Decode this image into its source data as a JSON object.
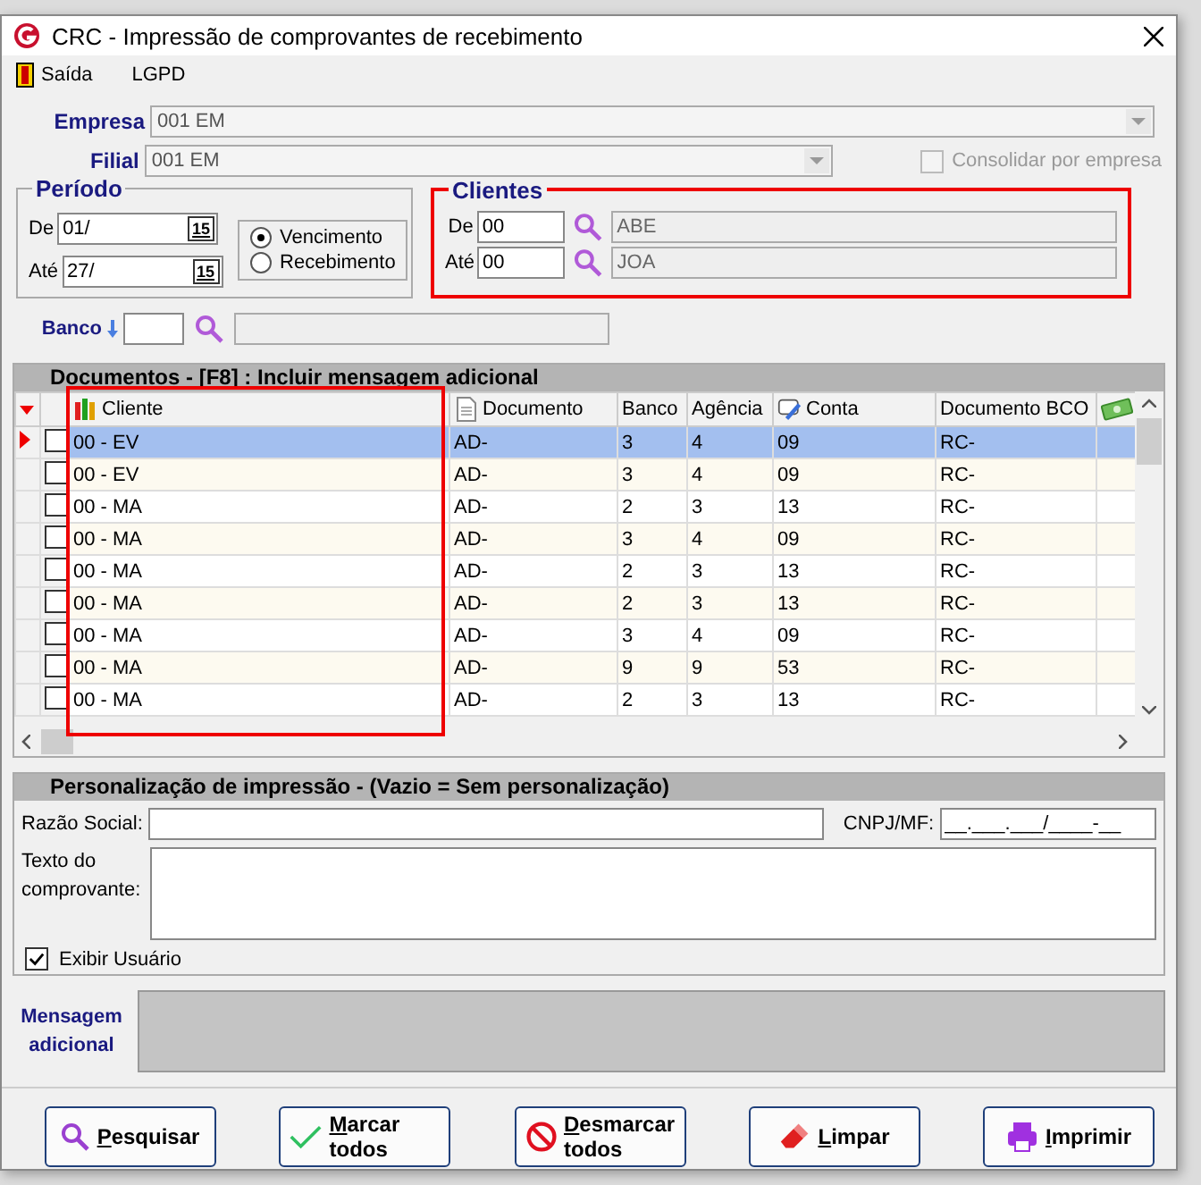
{
  "window": {
    "title": "CRC - Impressão de comprovantes de recebimento"
  },
  "menu": [
    "Saída",
    "LGPD"
  ],
  "empresa": {
    "label": "Empresa",
    "value": "001 EM"
  },
  "filial": {
    "label": "Filial",
    "value": "001 EM"
  },
  "consolidar": {
    "label": "Consolidar por empresa",
    "checked": false,
    "disabled": true
  },
  "periodo": {
    "title": "Período",
    "de_label": "De",
    "de": "01/",
    "ate_label": "Até",
    "ate": "27/",
    "de_calendar": "15",
    "ate_calendar": "15",
    "options": [
      {
        "label": "Vencimento",
        "selected": true
      },
      {
        "label": "Recebimento",
        "selected": false
      }
    ]
  },
  "clientes": {
    "title": "Clientes",
    "highlighted": true,
    "de_label": "De",
    "de_code": "00",
    "de_name": "ABE",
    "ate_label": "Até",
    "ate_code": "00",
    "ate_name": "JOA"
  },
  "banco": {
    "label": "Banco"
  },
  "documentos": {
    "title": "Documentos - [F8] : Incluir mensagem adicional",
    "columns": [
      {
        "label": "Cliente",
        "highlighted": true
      },
      {
        "label": "Documento"
      },
      {
        "label": "Banco"
      },
      {
        "label": "Agência"
      },
      {
        "label": "Conta"
      },
      {
        "label": "Documento BCO"
      }
    ],
    "rows": [
      {
        "selected": true,
        "checked": false,
        "cells": [
          "00 - EV",
          "AD-",
          "3",
          "4",
          "09",
          "RC-"
        ]
      },
      {
        "selected": false,
        "checked": false,
        "cells": [
          "00 - EV",
          "AD-",
          "3",
          "4",
          "09",
          "RC-"
        ]
      },
      {
        "selected": false,
        "checked": false,
        "cells": [
          "00 - MA",
          "AD-",
          "2",
          "3",
          "13",
          "RC-"
        ]
      },
      {
        "selected": false,
        "checked": false,
        "cells": [
          "00 - MA",
          "AD-",
          "3",
          "4",
          "09",
          "RC-"
        ]
      },
      {
        "selected": false,
        "checked": false,
        "cells": [
          "00 - MA",
          "AD-",
          "2",
          "3",
          "13",
          "RC-"
        ]
      },
      {
        "selected": false,
        "checked": false,
        "cells": [
          "00 - MA",
          "AD-",
          "2",
          "3",
          "13",
          "RC-"
        ]
      },
      {
        "selected": false,
        "checked": false,
        "cells": [
          "00 - MA",
          "AD-",
          "3",
          "4",
          "09",
          "RC-"
        ]
      },
      {
        "selected": false,
        "checked": false,
        "cells": [
          "00 - MA",
          "AD-",
          "9",
          "9",
          "53",
          "RC-"
        ]
      },
      {
        "selected": false,
        "checked": false,
        "cells": [
          "00 - MA",
          "AD-",
          "2",
          "3",
          "13",
          "RC-"
        ]
      }
    ]
  },
  "personalizacao": {
    "title": "Personalização de impressão - (Vazio = Sem personalização)",
    "razao_label": "Razão Social:",
    "cnpj_label": "CNPJ/MF:",
    "cnpj_value": "__.___.___/____-__",
    "texto_label": "Texto do comprovante:",
    "exibir": {
      "label": "Exibir Usuário",
      "checked": true
    }
  },
  "mensagem": {
    "label": "Mensagem adicional"
  },
  "buttons": [
    {
      "kind": "search",
      "label": "Pesquisar"
    },
    {
      "kind": "check",
      "label": "Marcar todos"
    },
    {
      "kind": "block",
      "label": "Desmarcar todos"
    },
    {
      "kind": "eraser",
      "label": "Limpar"
    },
    {
      "kind": "print",
      "label": "Imprimir"
    }
  ]
}
